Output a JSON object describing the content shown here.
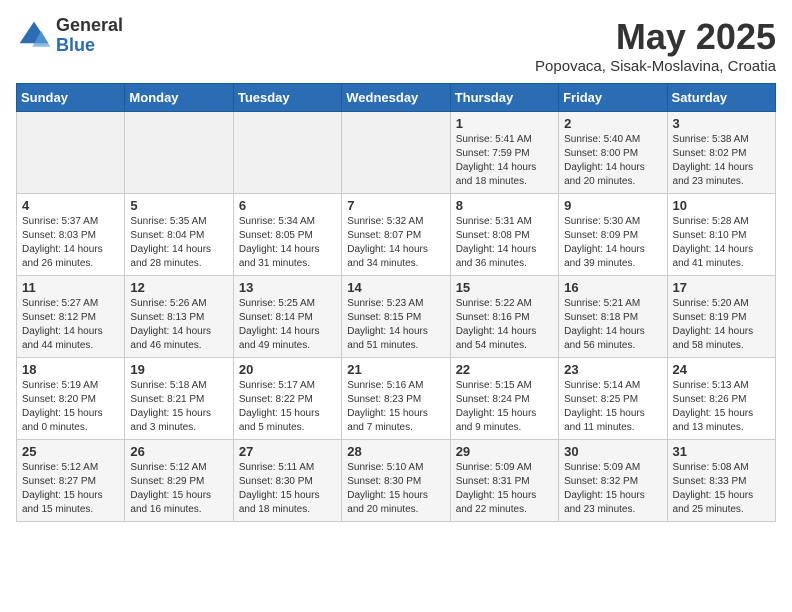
{
  "header": {
    "logo_general": "General",
    "logo_blue": "Blue",
    "title": "May 2025",
    "location": "Popovaca, Sisak-Moslavina, Croatia"
  },
  "weekdays": [
    "Sunday",
    "Monday",
    "Tuesday",
    "Wednesday",
    "Thursday",
    "Friday",
    "Saturday"
  ],
  "weeks": [
    [
      {
        "day": "",
        "info": ""
      },
      {
        "day": "",
        "info": ""
      },
      {
        "day": "",
        "info": ""
      },
      {
        "day": "",
        "info": ""
      },
      {
        "day": "1",
        "info": "Sunrise: 5:41 AM\nSunset: 7:59 PM\nDaylight: 14 hours\nand 18 minutes."
      },
      {
        "day": "2",
        "info": "Sunrise: 5:40 AM\nSunset: 8:00 PM\nDaylight: 14 hours\nand 20 minutes."
      },
      {
        "day": "3",
        "info": "Sunrise: 5:38 AM\nSunset: 8:02 PM\nDaylight: 14 hours\nand 23 minutes."
      }
    ],
    [
      {
        "day": "4",
        "info": "Sunrise: 5:37 AM\nSunset: 8:03 PM\nDaylight: 14 hours\nand 26 minutes."
      },
      {
        "day": "5",
        "info": "Sunrise: 5:35 AM\nSunset: 8:04 PM\nDaylight: 14 hours\nand 28 minutes."
      },
      {
        "day": "6",
        "info": "Sunrise: 5:34 AM\nSunset: 8:05 PM\nDaylight: 14 hours\nand 31 minutes."
      },
      {
        "day": "7",
        "info": "Sunrise: 5:32 AM\nSunset: 8:07 PM\nDaylight: 14 hours\nand 34 minutes."
      },
      {
        "day": "8",
        "info": "Sunrise: 5:31 AM\nSunset: 8:08 PM\nDaylight: 14 hours\nand 36 minutes."
      },
      {
        "day": "9",
        "info": "Sunrise: 5:30 AM\nSunset: 8:09 PM\nDaylight: 14 hours\nand 39 minutes."
      },
      {
        "day": "10",
        "info": "Sunrise: 5:28 AM\nSunset: 8:10 PM\nDaylight: 14 hours\nand 41 minutes."
      }
    ],
    [
      {
        "day": "11",
        "info": "Sunrise: 5:27 AM\nSunset: 8:12 PM\nDaylight: 14 hours\nand 44 minutes."
      },
      {
        "day": "12",
        "info": "Sunrise: 5:26 AM\nSunset: 8:13 PM\nDaylight: 14 hours\nand 46 minutes."
      },
      {
        "day": "13",
        "info": "Sunrise: 5:25 AM\nSunset: 8:14 PM\nDaylight: 14 hours\nand 49 minutes."
      },
      {
        "day": "14",
        "info": "Sunrise: 5:23 AM\nSunset: 8:15 PM\nDaylight: 14 hours\nand 51 minutes."
      },
      {
        "day": "15",
        "info": "Sunrise: 5:22 AM\nSunset: 8:16 PM\nDaylight: 14 hours\nand 54 minutes."
      },
      {
        "day": "16",
        "info": "Sunrise: 5:21 AM\nSunset: 8:18 PM\nDaylight: 14 hours\nand 56 minutes."
      },
      {
        "day": "17",
        "info": "Sunrise: 5:20 AM\nSunset: 8:19 PM\nDaylight: 14 hours\nand 58 minutes."
      }
    ],
    [
      {
        "day": "18",
        "info": "Sunrise: 5:19 AM\nSunset: 8:20 PM\nDaylight: 15 hours\nand 0 minutes."
      },
      {
        "day": "19",
        "info": "Sunrise: 5:18 AM\nSunset: 8:21 PM\nDaylight: 15 hours\nand 3 minutes."
      },
      {
        "day": "20",
        "info": "Sunrise: 5:17 AM\nSunset: 8:22 PM\nDaylight: 15 hours\nand 5 minutes."
      },
      {
        "day": "21",
        "info": "Sunrise: 5:16 AM\nSunset: 8:23 PM\nDaylight: 15 hours\nand 7 minutes."
      },
      {
        "day": "22",
        "info": "Sunrise: 5:15 AM\nSunset: 8:24 PM\nDaylight: 15 hours\nand 9 minutes."
      },
      {
        "day": "23",
        "info": "Sunrise: 5:14 AM\nSunset: 8:25 PM\nDaylight: 15 hours\nand 11 minutes."
      },
      {
        "day": "24",
        "info": "Sunrise: 5:13 AM\nSunset: 8:26 PM\nDaylight: 15 hours\nand 13 minutes."
      }
    ],
    [
      {
        "day": "25",
        "info": "Sunrise: 5:12 AM\nSunset: 8:27 PM\nDaylight: 15 hours\nand 15 minutes."
      },
      {
        "day": "26",
        "info": "Sunrise: 5:12 AM\nSunset: 8:29 PM\nDaylight: 15 hours\nand 16 minutes."
      },
      {
        "day": "27",
        "info": "Sunrise: 5:11 AM\nSunset: 8:30 PM\nDaylight: 15 hours\nand 18 minutes."
      },
      {
        "day": "28",
        "info": "Sunrise: 5:10 AM\nSunset: 8:30 PM\nDaylight: 15 hours\nand 20 minutes."
      },
      {
        "day": "29",
        "info": "Sunrise: 5:09 AM\nSunset: 8:31 PM\nDaylight: 15 hours\nand 22 minutes."
      },
      {
        "day": "30",
        "info": "Sunrise: 5:09 AM\nSunset: 8:32 PM\nDaylight: 15 hours\nand 23 minutes."
      },
      {
        "day": "31",
        "info": "Sunrise: 5:08 AM\nSunset: 8:33 PM\nDaylight: 15 hours\nand 25 minutes."
      }
    ]
  ]
}
